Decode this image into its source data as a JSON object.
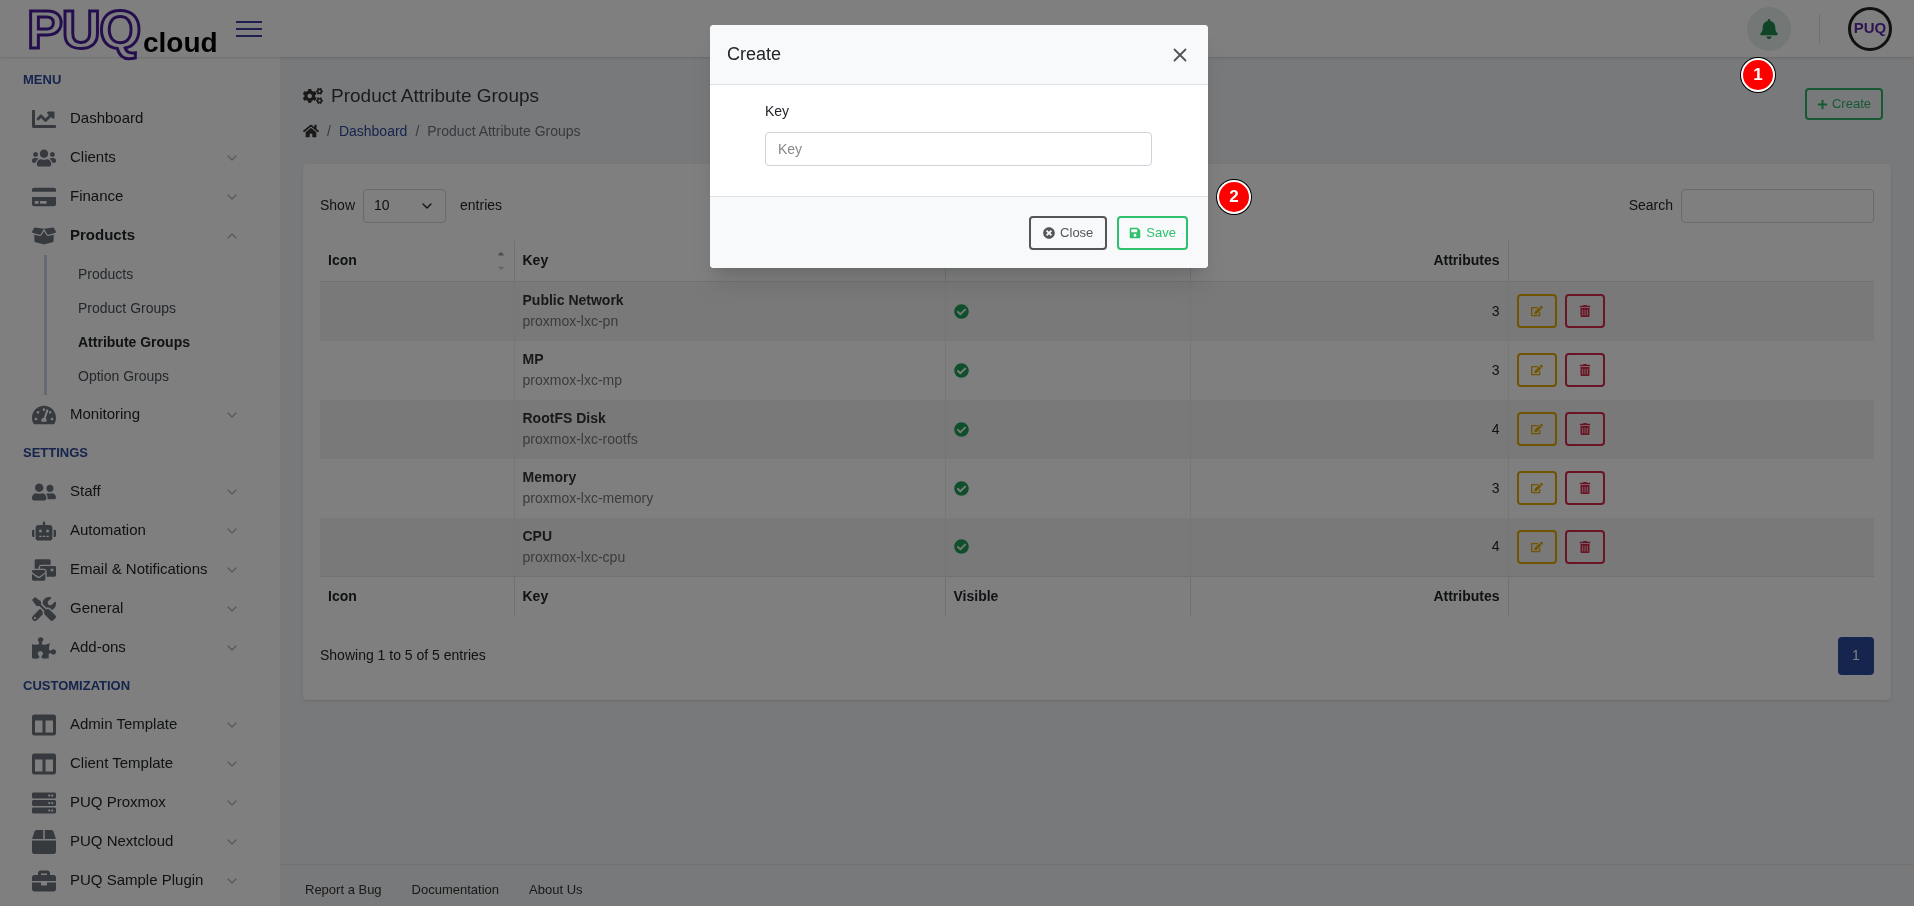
{
  "logo": {
    "mark": "PUQ",
    "word": "cloud"
  },
  "header": {
    "avatar": "PUQ"
  },
  "sidebar": {
    "sections": [
      {
        "title": "MENU",
        "items": [
          {
            "label": "Dashboard",
            "kind": "link"
          },
          {
            "label": "Clients",
            "kind": "group",
            "expanded": false
          },
          {
            "label": "Finance",
            "kind": "group",
            "expanded": false
          },
          {
            "label": "Products",
            "kind": "group",
            "expanded": true,
            "children": [
              {
                "label": "Products",
                "selected": false
              },
              {
                "label": "Product Groups",
                "selected": false
              },
              {
                "label": "Attribute Groups",
                "selected": true
              },
              {
                "label": "Option Groups",
                "selected": false
              }
            ]
          },
          {
            "label": "Monitoring",
            "kind": "group",
            "expanded": false
          }
        ]
      },
      {
        "title": "SETTINGS",
        "items": [
          {
            "label": "Staff",
            "kind": "group",
            "expanded": false
          },
          {
            "label": "Automation",
            "kind": "group",
            "expanded": false
          },
          {
            "label": "Email & Notifications",
            "kind": "group",
            "expanded": false
          },
          {
            "label": "General",
            "kind": "group",
            "expanded": false
          },
          {
            "label": "Add-ons",
            "kind": "group",
            "expanded": false
          }
        ]
      },
      {
        "title": "CUSTOMIZATION",
        "items": [
          {
            "label": "Admin Template",
            "kind": "group",
            "expanded": false
          },
          {
            "label": "Client Template",
            "kind": "group",
            "expanded": false
          },
          {
            "label": "PUQ Proxmox",
            "kind": "group",
            "expanded": false
          },
          {
            "label": "PUQ Nextcloud",
            "kind": "group",
            "expanded": false
          },
          {
            "label": "PUQ Sample Plugin",
            "kind": "group",
            "expanded": false
          }
        ]
      }
    ]
  },
  "page": {
    "title": "Product Attribute Groups",
    "breadcrumb": [
      {
        "separator": "/",
        "label": "Dashboard",
        "kind": "link"
      },
      {
        "separator": "/",
        "label": "Product Attribute Groups",
        "kind": "current"
      }
    ],
    "create_button": "Create"
  },
  "table_controls": {
    "show_label": "Show",
    "page_size": "10",
    "entries_label": "entries",
    "search_label": "Search"
  },
  "table": {
    "columns": {
      "icon": "Icon",
      "key": "Key",
      "attributes": "Attributes"
    },
    "rows": [
      {
        "name": "Public Network",
        "key": "proxmox-lxc-pn",
        "visible": true,
        "attributes": "3"
      },
      {
        "name": "MP",
        "key": "proxmox-lxc-mp",
        "visible": true,
        "attributes": "3"
      },
      {
        "name": "RootFS Disk",
        "key": "proxmox-lxc-rootfs",
        "visible": true,
        "attributes": "4"
      },
      {
        "name": "Memory",
        "key": "proxmox-lxc-memory",
        "visible": true,
        "attributes": "3"
      },
      {
        "name": "CPU",
        "key": "proxmox-lxc-cpu",
        "visible": true,
        "attributes": "4"
      }
    ],
    "footer_columns": [
      "Icon",
      "Key",
      "Visible",
      "Attributes"
    ]
  },
  "table_info": "Showing 1 to 5 of 5 entries",
  "pagination": [
    {
      "label": "1",
      "selected": true
    }
  ],
  "footer_links": [
    "Report a Bug",
    "Documentation",
    "About Us"
  ],
  "modal": {
    "title": "Create",
    "field_label": "Key",
    "field_placeholder": "Key",
    "buttons": [
      {
        "label": "Close",
        "kind": "close"
      },
      {
        "label": "Save",
        "kind": "save"
      }
    ]
  },
  "callouts": [
    "1",
    "2"
  ]
}
